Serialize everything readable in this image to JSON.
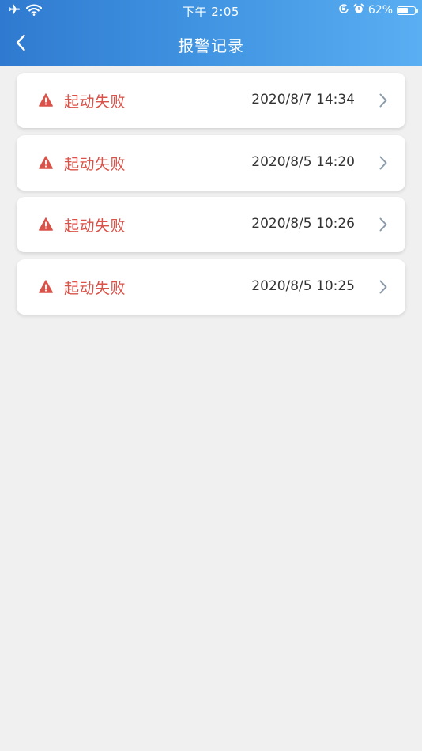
{
  "status_bar": {
    "time": "下午 2:05",
    "battery_percent": "62%",
    "battery_level": 0.62
  },
  "header": {
    "title": "报警记录"
  },
  "alarms": [
    {
      "label": "起动失败",
      "time": "2020/8/7 14:34"
    },
    {
      "label": "起动失败",
      "time": "2020/8/5 14:20"
    },
    {
      "label": "起动失败",
      "time": "2020/8/5 10:26"
    },
    {
      "label": "起动失败",
      "time": "2020/8/5 10:25"
    }
  ],
  "colors": {
    "header_gradient_start": "#2f7ad0",
    "header_gradient_end": "#5aaef2",
    "alarm_red": "#d9534a",
    "background": "#f0f0f0"
  },
  "icons": {
    "back": "chevron-left-icon",
    "warning": "warning-triangle-icon",
    "row_action": "chevron-right-icon"
  }
}
